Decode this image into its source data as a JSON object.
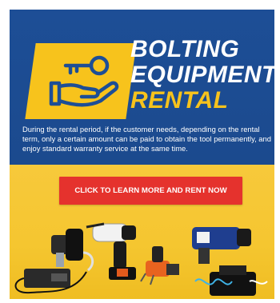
{
  "title": {
    "line1": "BOLTING",
    "line2": "EQUIPMENT",
    "line3": "RENTAL"
  },
  "description": "During the rental period, if the customer needs, depending on the rental term, only a certain amount can be paid to obtain the tool permanently, and enjoy standard warranty service at the same time.",
  "cta_label": "CLICK TO LEARN MORE AND RENT NOW",
  "colors": {
    "top_bg": "#1d4e96",
    "bottom_bg": "#f5c630",
    "accent_yellow": "#f7c31c",
    "cta_red": "#e5322d"
  },
  "icons": [
    "hand-key-icon"
  ]
}
